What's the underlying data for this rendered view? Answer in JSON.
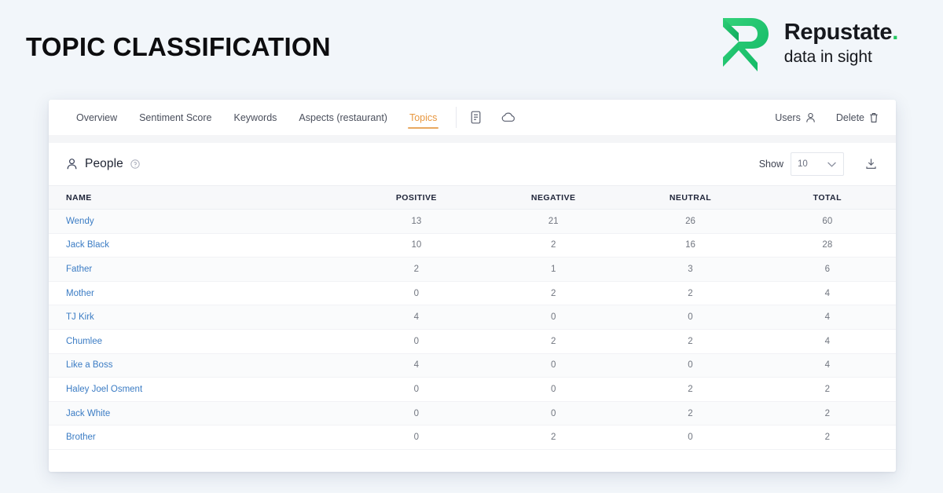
{
  "banner": {
    "title": "TOPIC CLASSIFICATION",
    "logo": {
      "mark_name": "repustate-r-mark",
      "name": "Repustate",
      "dot": ".",
      "tagline": "data in sight",
      "green": "#22c55e"
    }
  },
  "app": {
    "tabs": [
      {
        "label": "Overview",
        "active": false
      },
      {
        "label": "Sentiment Score",
        "active": false
      },
      {
        "label": "Keywords",
        "active": false
      },
      {
        "label": "Aspects (restaurant)",
        "active": false
      },
      {
        "label": "Topics",
        "active": true
      }
    ],
    "icon_tabs": [
      {
        "name": "report-icon"
      },
      {
        "name": "cloud-icon"
      }
    ],
    "actions": [
      {
        "label": "Users",
        "icon": "user-icon"
      },
      {
        "label": "Delete",
        "icon": "trash-icon"
      }
    ],
    "active_tab_color": "#e8973f"
  },
  "panel": {
    "title": "People",
    "title_icon": "person-icon",
    "help_icon": "help-circle-icon",
    "show_label": "Show",
    "show_value": "10",
    "export_icon": "download-icon",
    "table": {
      "columns": [
        "NAME",
        "POSITIVE",
        "NEGATIVE",
        "NEUTRAL",
        "TOTAL"
      ],
      "rows": [
        {
          "name": "Wendy",
          "positive": "13",
          "negative": "21",
          "neutral": "26",
          "total": "60"
        },
        {
          "name": "Jack Black",
          "positive": "10",
          "negative": "2",
          "neutral": "16",
          "total": "28"
        },
        {
          "name": "Father",
          "positive": "2",
          "negative": "1",
          "neutral": "3",
          "total": "6"
        },
        {
          "name": "Mother",
          "positive": "0",
          "negative": "2",
          "neutral": "2",
          "total": "4"
        },
        {
          "name": "TJ Kirk",
          "positive": "4",
          "negative": "0",
          "neutral": "0",
          "total": "4"
        },
        {
          "name": "Chumlee",
          "positive": "0",
          "negative": "2",
          "neutral": "2",
          "total": "4"
        },
        {
          "name": "Like a Boss",
          "positive": "4",
          "negative": "0",
          "neutral": "0",
          "total": "4"
        },
        {
          "name": "Haley Joel Osment",
          "positive": "0",
          "negative": "0",
          "neutral": "2",
          "total": "2"
        },
        {
          "name": "Jack White",
          "positive": "0",
          "negative": "0",
          "neutral": "2",
          "total": "2"
        },
        {
          "name": "Brother",
          "positive": "0",
          "negative": "2",
          "neutral": "0",
          "total": "2"
        }
      ]
    }
  }
}
